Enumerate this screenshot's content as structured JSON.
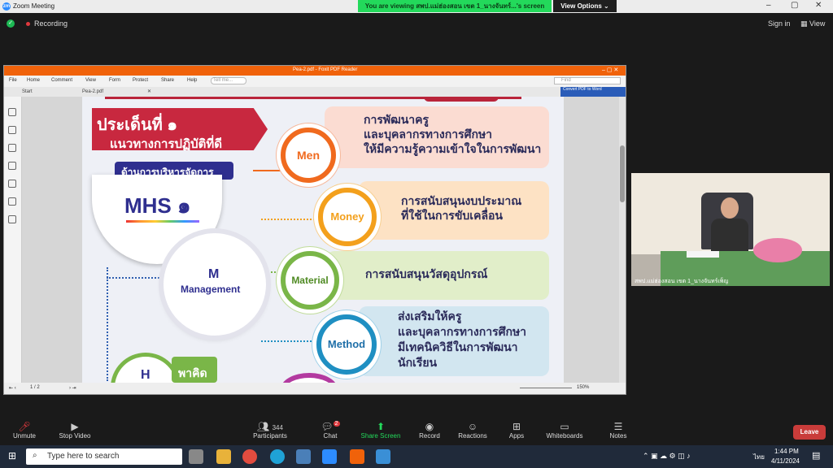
{
  "app_title": "Zoom Meeting",
  "banner": {
    "viewing": "You are viewing สพป.แม่ฮ่องสอน เขต 1_นางจันทร์...'s screen",
    "view_options": "View Options"
  },
  "topbar": {
    "recording": "Recording",
    "sign_in": "Sign in",
    "view": "View"
  },
  "pdf": {
    "title": "Pea-2.pdf - Foxit PDF Reader",
    "menu": [
      "File",
      "Home",
      "Comment",
      "View",
      "Form",
      "Protect",
      "Share",
      "Help"
    ],
    "tell_me": "Tell me...",
    "find": "Find",
    "tabs": {
      "start": "Start",
      "doc": "Pea-2.pdf"
    },
    "convert": "Convert PDF to Word",
    "page_indicator": "1 / 2",
    "zoom": "150%"
  },
  "slide": {
    "heading1": "ประเด็นที่ ๑",
    "heading2": "แนวทางการปฏิบัติที่ดี",
    "heading3": "ด้านการบริหารจัดการ",
    "mhs": "MHS ๑",
    "m_letter": "M",
    "management": "Management",
    "h_letter": "H",
    "h_sub": "พาคิด",
    "nodes": [
      {
        "label": "Men",
        "text": [
          "การพัฒนาครู",
          "และบุคลากรทางการศึกษา",
          "ให้มีความรู้ความเข้าใจในการพัฒนา"
        ],
        "color": "#f06a1e"
      },
      {
        "label": "Money",
        "text": [
          "การสนับสนุนงบประมาณ",
          "ที่ใช้ในการขับเคลื่อน"
        ],
        "color": "#f3a01c"
      },
      {
        "label": "Material",
        "text": [
          "การสนับสนุนวัสดุอุปกรณ์"
        ],
        "color": "#7ab648"
      },
      {
        "label": "Method",
        "text": [
          "ส่งเสริมให้ครู",
          "และบุคลากรทางการศึกษา",
          "มีเทคนิควิธีในการพัฒนา",
          "นักเรียน"
        ],
        "color": "#1f8fc2"
      }
    ]
  },
  "video": {
    "name": "สพป.แม่ฮ่องสอน เขต 1_นางจันทร์เพ็ญ"
  },
  "toolbar": {
    "unmute": "Unmute",
    "stop_video": "Stop Video",
    "participants": "Participants",
    "participants_count": "344",
    "chat": "Chat",
    "chat_badge": "2",
    "share_screen": "Share Screen",
    "record": "Record",
    "reactions": "Reactions",
    "apps": "Apps",
    "whiteboards": "Whiteboards",
    "notes": "Notes",
    "leave": "Leave"
  },
  "taskbar": {
    "search": "Type here to search",
    "time": "1:44 PM",
    "date": "4/11/2024",
    "lang": "ไทย"
  }
}
